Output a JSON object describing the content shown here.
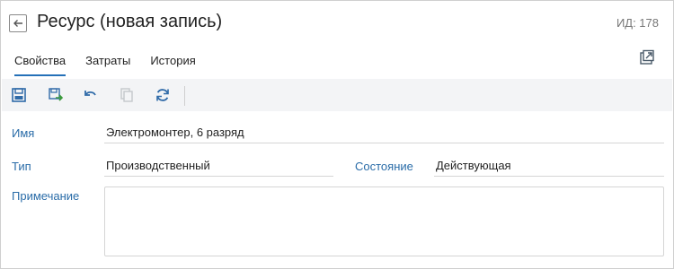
{
  "header": {
    "title": "Ресурс (новая запись)",
    "id_label": "ИД: 178"
  },
  "tabs": [
    {
      "label": "Свойства",
      "active": true
    },
    {
      "label": "Затраты",
      "active": false
    },
    {
      "label": "История",
      "active": false
    }
  ],
  "toolbar": {
    "icons": [
      "save-icon",
      "save-and-close-icon",
      "undo-icon",
      "copy-icon",
      "refresh-icon"
    ]
  },
  "form": {
    "name_label": "Имя",
    "name_value": "Электромонтер, 6 разряд",
    "type_label": "Тип",
    "type_value": "Производственный",
    "state_label": "Состояние",
    "state_value": "Действующая",
    "note_label": "Примечание",
    "note_value": ""
  },
  "colors": {
    "accent": "#2470b8",
    "label": "#2a6ca8",
    "toolbar_bg": "#f3f4f6"
  }
}
